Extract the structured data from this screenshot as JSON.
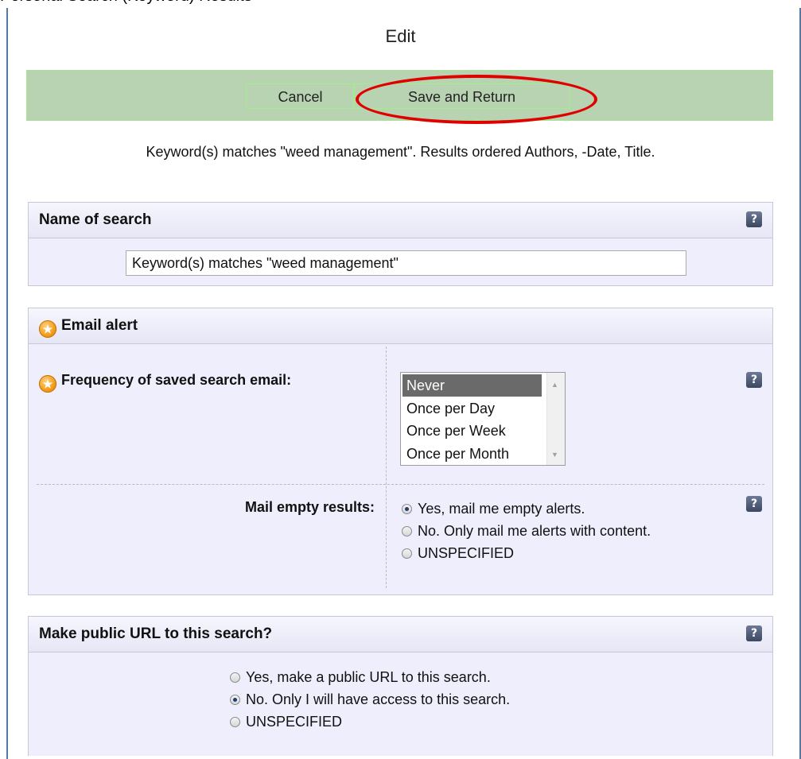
{
  "top_clipped_text": "Personal Search (Keyword) Results",
  "page": {
    "title": "Edit"
  },
  "toolbar": {
    "cancel_label": "Cancel",
    "save_label": "Save and Return"
  },
  "summary": "Keyword(s) matches \"weed management\". Results ordered Authors, -Date, Title.",
  "name_section": {
    "title": "Name of search",
    "help": "?",
    "value": "Keyword(s) matches \"weed management\""
  },
  "email_section": {
    "title": "Email alert",
    "frequency_label": "Frequency of saved search email:",
    "frequency_options": [
      "Never",
      "Once per Day",
      "Once per Week",
      "Once per Month"
    ],
    "frequency_selected": "Never",
    "empty_label": "Mail empty results:",
    "empty_options": [
      "Yes, mail me empty alerts.",
      "No. Only mail me alerts with content.",
      "UNSPECIFIED"
    ],
    "empty_selected": "Yes, mail me empty alerts.",
    "help": "?"
  },
  "public_section": {
    "title": "Make public URL to this search?",
    "options": [
      "Yes, make a public URL to this search.",
      "No. Only I will have access to this search.",
      "UNSPECIFIED"
    ],
    "selected": "No. Only I will have access to this search.",
    "help": "?"
  },
  "colors": {
    "toolbar_bg": "#b8d3b2",
    "highlight_ellipse": "#e00000",
    "panel_bg": "#eeeefc",
    "star": "#f29a18"
  },
  "icons": {
    "star": "star-icon",
    "help": "help-icon"
  }
}
